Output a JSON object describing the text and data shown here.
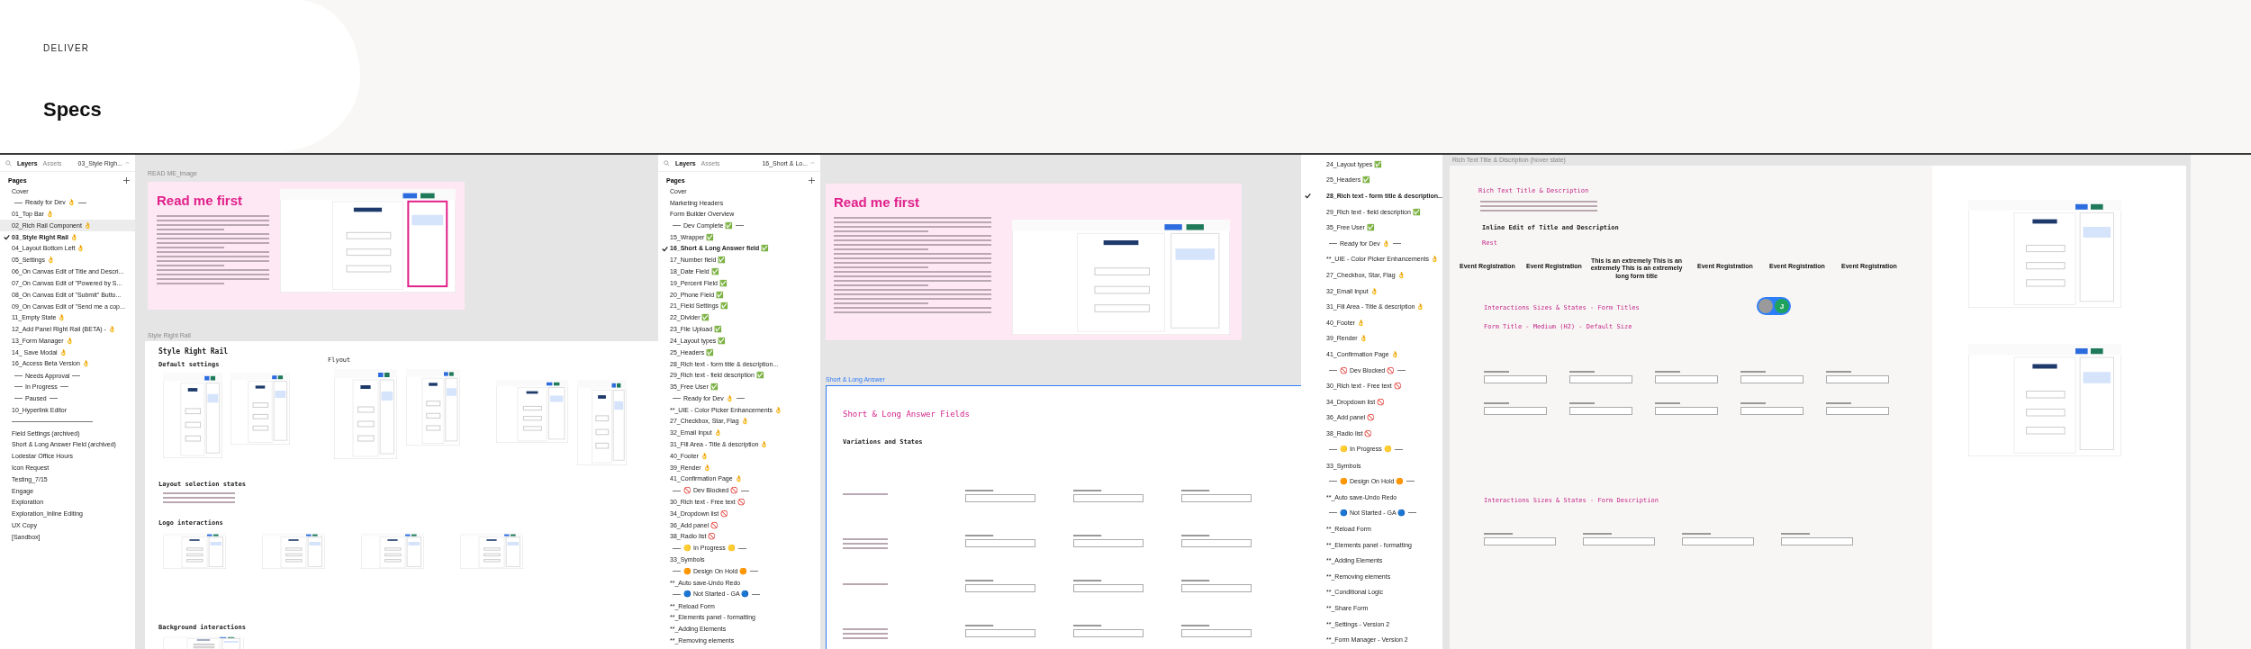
{
  "header": {
    "eyebrow": "DELIVER",
    "title": "Specs"
  },
  "panels": [
    {
      "tabs": [
        {
          "label": "Layers",
          "selected": true
        },
        {
          "label": "Assets",
          "selected": false
        }
      ],
      "page_picker": "03_Style Righ...",
      "pages_title": "Pages",
      "pages": [
        {
          "kind": "page",
          "label": "Cover",
          "selected": false,
          "hovered": false
        },
        {
          "kind": "section",
          "label": "Ready for Dev 👌"
        },
        {
          "kind": "page",
          "label": "01_Top Bar 👌",
          "selected": false,
          "hovered": false
        },
        {
          "kind": "page",
          "label": "02_Rich Rail Component 👌",
          "selected": false,
          "hovered": true
        },
        {
          "kind": "page",
          "label": "03_Style Right Rail 👌",
          "selected": true,
          "hovered": false
        },
        {
          "kind": "page",
          "label": "04_Layout Bottom Left 👌",
          "selected": false,
          "hovered": false
        },
        {
          "kind": "page",
          "label": "05_Settings 👌",
          "selected": false,
          "hovered": false
        },
        {
          "kind": "page",
          "label": "06_On Canvas Edit of Title and Descri...",
          "selected": false,
          "hovered": false
        },
        {
          "kind": "page",
          "label": "07_On Canvas Edit of \"Powered by S...",
          "selected": false,
          "hovered": false
        },
        {
          "kind": "page",
          "label": "08_On Canvas Edit of \"Submit\" Butto...",
          "selected": false,
          "hovered": false
        },
        {
          "kind": "page",
          "label": "09_On Canvas Edit of \"Send me a cop...",
          "selected": false,
          "hovered": false
        },
        {
          "kind": "page",
          "label": "11_Empty State 👌",
          "selected": false,
          "hovered": false
        },
        {
          "kind": "page",
          "label": "12_Add Panel Right Rail (BETA) - 👌",
          "selected": false,
          "hovered": false
        },
        {
          "kind": "page",
          "label": "13_Form Manager 👌",
          "selected": false,
          "hovered": false
        },
        {
          "kind": "page",
          "label": "14_ Save Modal 👌",
          "selected": false,
          "hovered": false
        },
        {
          "kind": "page",
          "label": "16_Access Beta Version 👌",
          "selected": false,
          "hovered": false
        },
        {
          "kind": "section",
          "label": "Needs Approval"
        },
        {
          "kind": "section",
          "label": "In Progress"
        },
        {
          "kind": "section",
          "label": "Paused"
        },
        {
          "kind": "page",
          "label": "10_Hyperlink Editor",
          "selected": false,
          "hovered": false
        },
        {
          "kind": "divider"
        },
        {
          "kind": "page",
          "label": "Field Settings (archived)",
          "selected": false,
          "hovered": false
        },
        {
          "kind": "page",
          "label": "Short & Long Answer Field (archived)",
          "selected": false,
          "hovered": false
        },
        {
          "kind": "page",
          "label": "Lodestar Office Hours",
          "selected": false,
          "hovered": false
        },
        {
          "kind": "page",
          "label": "Icon Request",
          "selected": false,
          "hovered": false
        },
        {
          "kind": "page",
          "label": "Testing_7/15",
          "selected": false,
          "hovered": false
        },
        {
          "kind": "page",
          "label": "Engage",
          "selected": false,
          "hovered": false
        },
        {
          "kind": "page",
          "label": "Exploration",
          "selected": false,
          "hovered": false
        },
        {
          "kind": "page",
          "label": "Exploration_Inline Editing",
          "selected": false,
          "hovered": false
        },
        {
          "kind": "page",
          "label": "UX Copy",
          "selected": false,
          "hovered": false
        },
        {
          "kind": "page",
          "label": "[Sandbox]",
          "selected": false,
          "hovered": false
        }
      ]
    },
    {
      "tabs": [
        {
          "label": "Layers",
          "selected": true
        },
        {
          "label": "Assets",
          "selected": false
        }
      ],
      "page_picker": "16_Short & Lo...",
      "pages_title": "Pages",
      "pages": [
        {
          "kind": "page",
          "label": "Cover",
          "selected": false
        },
        {
          "kind": "page",
          "label": "Marketing Headers",
          "selected": false
        },
        {
          "kind": "page",
          "label": "Form Builder Overview",
          "selected": false
        },
        {
          "kind": "section",
          "label": "Dev Complete ✅"
        },
        {
          "kind": "page",
          "label": "15_Wrapper ✅",
          "selected": false
        },
        {
          "kind": "page",
          "label": "16_Short & Long Answer field ✅",
          "selected": true
        },
        {
          "kind": "page",
          "label": "17_Number field ✅",
          "selected": false
        },
        {
          "kind": "page",
          "label": "18_Date Field ✅",
          "selected": false
        },
        {
          "kind": "page",
          "label": "19_Percent Field ✅",
          "selected": false
        },
        {
          "kind": "page",
          "label": "20_Phone Field ✅",
          "selected": false
        },
        {
          "kind": "page",
          "label": "21_Field Settings ✅",
          "selected": false
        },
        {
          "kind": "page",
          "label": "22_Divider ✅",
          "selected": false
        },
        {
          "kind": "page",
          "label": "23_File Upload ✅",
          "selected": false
        },
        {
          "kind": "page",
          "label": "24_Layout types ✅",
          "selected": false
        },
        {
          "kind": "page",
          "label": "25_Headers ✅",
          "selected": false
        },
        {
          "kind": "page",
          "label": "28_Rich text - form title & description...",
          "selected": false
        },
        {
          "kind": "page",
          "label": "29_Rich text - field description ✅",
          "selected": false
        },
        {
          "kind": "page",
          "label": "35_Free User ✅",
          "selected": false
        },
        {
          "kind": "section",
          "label": "Ready for Dev 👌"
        },
        {
          "kind": "page",
          "label": "**_UIE - Color Picker Enhancements 👌",
          "selected": false
        },
        {
          "kind": "page",
          "label": "27_Checkbox, Star, Flag 👌",
          "selected": false
        },
        {
          "kind": "page",
          "label": "32_Email Input 👌",
          "selected": false
        },
        {
          "kind": "page",
          "label": "31_Fill Area - Title & description 👌",
          "selected": false
        },
        {
          "kind": "page",
          "label": "40_Footer 👌",
          "selected": false
        },
        {
          "kind": "page",
          "label": "39_Render 👌",
          "selected": false
        },
        {
          "kind": "page",
          "label": "41_Confirmation Page 👌",
          "selected": false
        },
        {
          "kind": "section",
          "label": "🚫 Dev Blocked 🚫"
        },
        {
          "kind": "page",
          "label": "30_Rich text - Free text 🚫",
          "selected": false
        },
        {
          "kind": "page",
          "label": "34_Dropdown list 🚫",
          "selected": false
        },
        {
          "kind": "page",
          "label": "36_Add panel 🚫",
          "selected": false
        },
        {
          "kind": "page",
          "label": "38_Radio list 🚫",
          "selected": false
        },
        {
          "kind": "section",
          "label": "🟡 In Progress 🟡"
        },
        {
          "kind": "page",
          "label": "33_Symbols",
          "selected": false
        },
        {
          "kind": "section",
          "label": "🟠 Design On Hold 🟠"
        },
        {
          "kind": "page",
          "label": "**_Auto save-Undo Redo",
          "selected": false
        },
        {
          "kind": "section",
          "label": "🔵 Not Started - GA 🔵"
        },
        {
          "kind": "page",
          "label": "**_Reload Form",
          "selected": false
        },
        {
          "kind": "page",
          "label": "**_Elements panel - formatting",
          "selected": false
        },
        {
          "kind": "page",
          "label": "**_Adding Elements",
          "selected": false
        },
        {
          "kind": "page",
          "label": "**_Removing elements",
          "selected": false
        }
      ]
    },
    {
      "pages": [
        {
          "kind": "page",
          "label": "24_Layout types ✅",
          "selected": false
        },
        {
          "kind": "page",
          "label": "25_Headers ✅",
          "selected": false
        },
        {
          "kind": "page",
          "label": "28_Rich text - form title & description...",
          "selected": true
        },
        {
          "kind": "page",
          "label": "29_Rich text - field description ✅",
          "selected": false
        },
        {
          "kind": "page",
          "label": "35_Free User ✅",
          "selected": false
        },
        {
          "kind": "section",
          "label": "Ready for Dev 👌"
        },
        {
          "kind": "page",
          "label": "**_UIE - Color Picker Enhancements 👌",
          "selected": false
        },
        {
          "kind": "page",
          "label": "27_Checkbox, Star, Flag 👌",
          "selected": false
        },
        {
          "kind": "page",
          "label": "32_Email Input 👌",
          "selected": false
        },
        {
          "kind": "page",
          "label": "31_Fill Area - Title & description 👌",
          "selected": false
        },
        {
          "kind": "page",
          "label": "40_Footer 👌",
          "selected": false
        },
        {
          "kind": "page",
          "label": "39_Render 👌",
          "selected": false
        },
        {
          "kind": "page",
          "label": "41_Confirmation Page 👌",
          "selected": false
        },
        {
          "kind": "section",
          "label": "🚫 Dev Blocked 🚫"
        },
        {
          "kind": "page",
          "label": "30_Rich text - Free text 🚫",
          "selected": false
        },
        {
          "kind": "page",
          "label": "34_Dropdown list 🚫",
          "selected": false
        },
        {
          "kind": "page",
          "label": "36_Add panel 🚫",
          "selected": false
        },
        {
          "kind": "page",
          "label": "38_Radio list 🚫",
          "selected": false
        },
        {
          "kind": "section",
          "label": "🟡 In Progress 🟡"
        },
        {
          "kind": "page",
          "label": "33_Symbols",
          "selected": false
        },
        {
          "kind": "section",
          "label": "🟠 Design On Hold 🟠"
        },
        {
          "kind": "page",
          "label": "**_Auto save-Undo Redo",
          "selected": false
        },
        {
          "kind": "section",
          "label": "🔵 Not Started - GA 🔵"
        },
        {
          "kind": "page",
          "label": "**_Reload Form",
          "selected": false
        },
        {
          "kind": "page",
          "label": "**_Elements panel - formatting",
          "selected": false
        },
        {
          "kind": "page",
          "label": "**_Adding Elements",
          "selected": false
        },
        {
          "kind": "page",
          "label": "**_Removing elements",
          "selected": false
        },
        {
          "kind": "page",
          "label": "**_Conditional Logic",
          "selected": false
        },
        {
          "kind": "page",
          "label": "**_Share Form",
          "selected": false
        },
        {
          "kind": "page",
          "label": "**_Settings - Version 2",
          "selected": false
        },
        {
          "kind": "page",
          "label": "**_Form Manager - Version 2",
          "selected": false
        }
      ]
    }
  ],
  "canvas_1": {
    "readme_label": "READ ME_image",
    "readme_title": "Read me first",
    "style_label": "Style Right Rail",
    "style_title": "Style Right Rail",
    "flyout": "Flyout",
    "sections": [
      "Default settings",
      "Layout selection states",
      "Logo interactions",
      "Background interactions"
    ]
  },
  "canvas_2": {
    "readme_title": "Read me first",
    "frame_label": "Short & Long Answer",
    "title": "Short & Long Answer Fields",
    "subtitle": "Variations and States"
  },
  "canvas_3": {
    "frame_label": "Rich Text Title & Discription (hover state)",
    "title": "Rich Text Title & Description",
    "subtitle": "Inline Edit of Title and Description",
    "rest": "Rest",
    "sections": [
      "Interactions Sizes & States - Form Titles",
      "Form Title - Medium (H2) - Default Size",
      "Interactions Sizes & States - Form Description"
    ],
    "samples": [
      "Event Registration",
      "Event Registration",
      "This is an extremely This is an extremely This is an extremely long form title",
      "Event Registration",
      "Event Registration",
      "Event Registration"
    ],
    "avatar_initial": "J"
  }
}
